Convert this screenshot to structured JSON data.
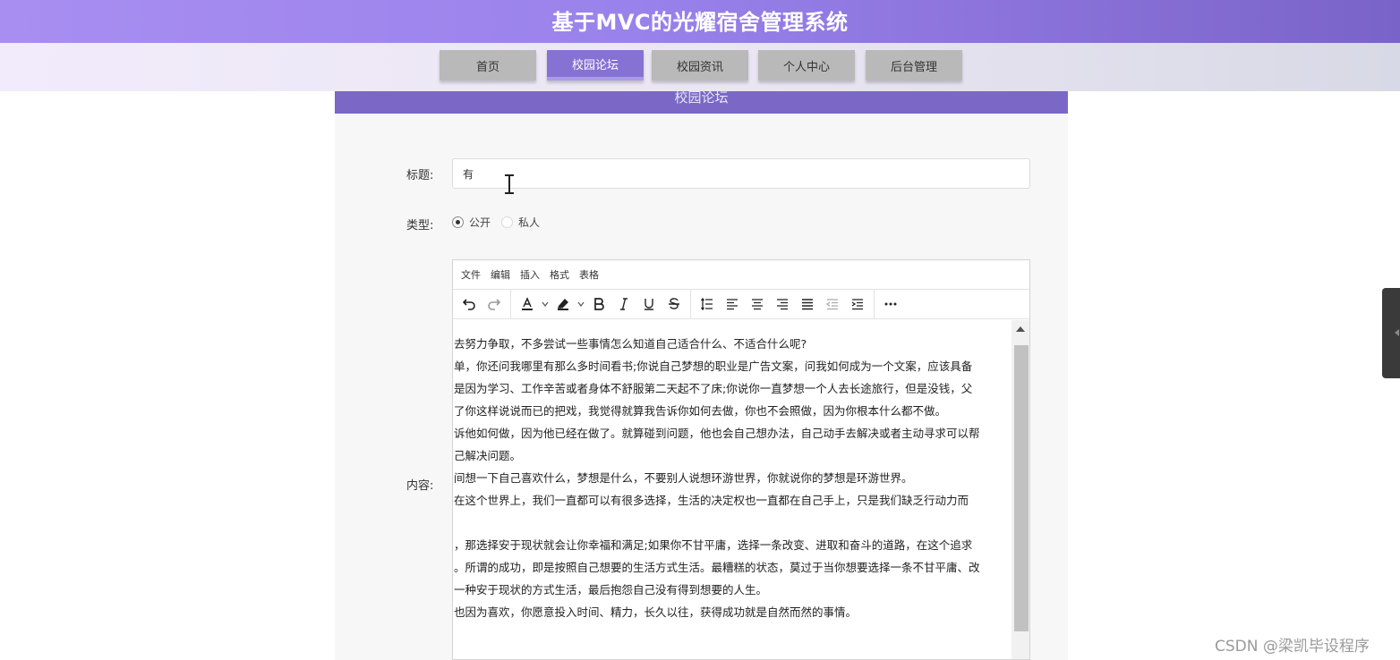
{
  "app": {
    "title": "基于MVC的光耀宿舍管理系统"
  },
  "nav": {
    "items": [
      {
        "label": "首页",
        "active": false
      },
      {
        "label": "校园论坛",
        "active": true
      },
      {
        "label": "校园资讯",
        "active": false
      },
      {
        "label": "个人中心",
        "active": false
      },
      {
        "label": "后台管理",
        "active": false
      }
    ]
  },
  "panel": {
    "heading": "校园论坛"
  },
  "form": {
    "title_label": "标题:",
    "title_value": "有",
    "type_label": "类型:",
    "type_options": [
      {
        "label": "公开",
        "checked": true
      },
      {
        "label": "私人",
        "checked": false
      }
    ],
    "content_label": "内容:"
  },
  "editor": {
    "menu": [
      "文件",
      "编辑",
      "插入",
      "格式",
      "表格"
    ],
    "toolbar_icons": [
      "undo-icon",
      "redo-icon",
      "font-color-icon",
      "highlight-icon",
      "bold-icon",
      "italic-icon",
      "underline-icon",
      "strikethrough-icon",
      "line-height-icon",
      "align-left-icon",
      "align-center-icon",
      "align-right-icon",
      "align-justify-icon",
      "outdent-icon",
      "indent-icon",
      "more-icon"
    ],
    "content_lines": [
      "去努力争取，不多尝试一些事情怎么知道自己适合什么、不适合什么呢?",
      "单，你还问我哪里有那么多时间看书;你说自己梦想的职业是广告文案，问我如何成为一个文案，应该具备",
      "是因为学习、工作辛苦或者身体不舒服第二天起不了床;你说你一直梦想一个人去长途旅行，但是没钱，父",
      "了你这样说说而已的把戏，我觉得就算我告诉你如何去做，你也不会照做，因为你根本什么都不做。",
      "诉他如何做，因为他已经在做了。就算碰到问题，他也会自己想办法，自己动手去解决或者主动寻求可以帮",
      "己解决问题。",
      "间想一下自己喜欢什么，梦想是什么，不要别人说想环游世界，你就说你的梦想是环游世界。",
      "在这个世界上，我们一直都可以有很多选择，生活的决定权也一直都在自己手上，只是我们缺乏行动力而",
      "",
      "，那选择安于现状就会让你幸福和满足;如果你不甘平庸，选择一条改变、进取和奋斗的道路，在这个追求",
      "。所谓的成功，即是按照自己想要的生活方式生活。最糟糕的状态，莫过于当你想要选择一条不甘平庸、改",
      "一种安于现状的方式生活，最后抱怨自己没有得到想要的人生。",
      "也因为喜欢，你愿意投入时间、精力，长久以往，获得成功就是自然而然的事情。"
    ]
  },
  "colors": {
    "header_start": "#a88ef0",
    "header_end": "#7a63c8",
    "nav_active": "#8672d2",
    "panel_head": "#7b68c6"
  },
  "watermark": "CSDN @梁凯毕设程序"
}
